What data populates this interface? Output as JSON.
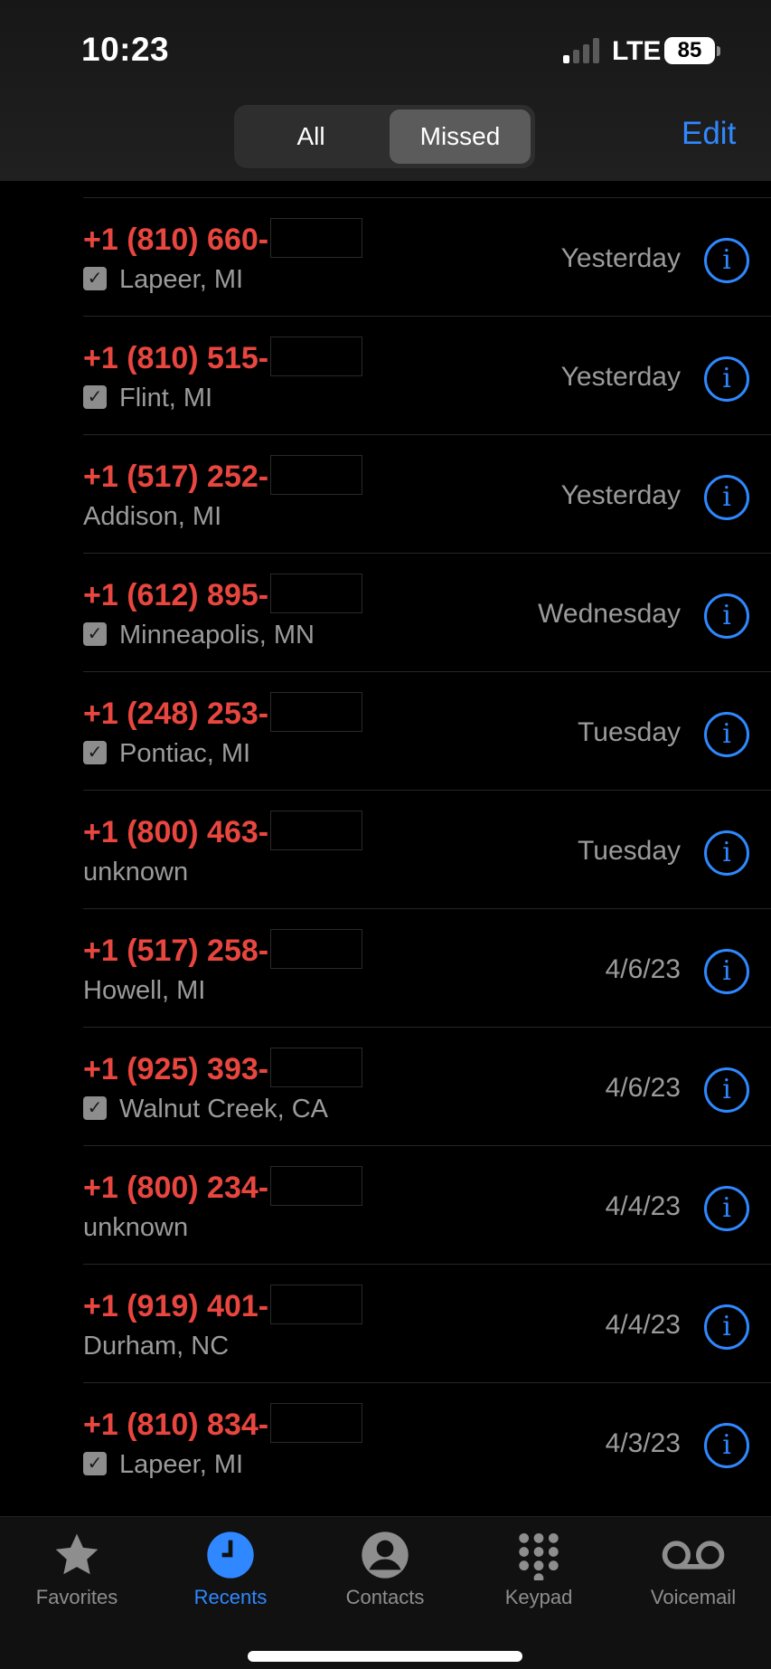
{
  "status": {
    "time": "10:23",
    "network": "LTE",
    "battery": "85"
  },
  "header": {
    "segments": [
      "All",
      "Missed"
    ],
    "selected": "Missed",
    "edit_label": "Edit"
  },
  "calls": [
    {
      "number": "+1 (810) 660-",
      "location": "Lapeer, MI",
      "verified": true,
      "date": "Yesterday"
    },
    {
      "number": "+1 (810) 515-",
      "location": "Flint, MI",
      "verified": true,
      "date": "Yesterday"
    },
    {
      "number": "+1 (517) 252-",
      "location": "Addison, MI",
      "verified": false,
      "date": "Yesterday"
    },
    {
      "number": "+1 (612) 895-",
      "location": "Minneapolis, MN",
      "verified": true,
      "date": "Wednesday"
    },
    {
      "number": "+1 (248) 253-",
      "location": "Pontiac, MI",
      "verified": true,
      "date": "Tuesday"
    },
    {
      "number": "+1 (800) 463-",
      "location": "unknown",
      "verified": false,
      "date": "Tuesday"
    },
    {
      "number": "+1 (517) 258-",
      "location": "Howell, MI",
      "verified": false,
      "date": "4/6/23"
    },
    {
      "number": "+1 (925) 393-",
      "location": "Walnut Creek, CA",
      "verified": true,
      "date": "4/6/23"
    },
    {
      "number": "+1 (800) 234-",
      "location": "unknown",
      "verified": false,
      "date": "4/4/23"
    },
    {
      "number": "+1 (919) 401-",
      "location": "Durham, NC",
      "verified": false,
      "date": "4/4/23"
    },
    {
      "number": "+1 (810) 834-",
      "location": "Lapeer, MI",
      "verified": true,
      "date": "4/3/23"
    }
  ],
  "tabs": [
    {
      "label": "Favorites",
      "icon": "star-icon"
    },
    {
      "label": "Recents",
      "icon": "clock-icon",
      "active": true
    },
    {
      "label": "Contacts",
      "icon": "person-icon"
    },
    {
      "label": "Keypad",
      "icon": "keypad-icon"
    },
    {
      "label": "Voicemail",
      "icon": "voicemail-icon"
    }
  ],
  "colors": {
    "accent": "#2f88ff",
    "missed": "#e8463f"
  }
}
